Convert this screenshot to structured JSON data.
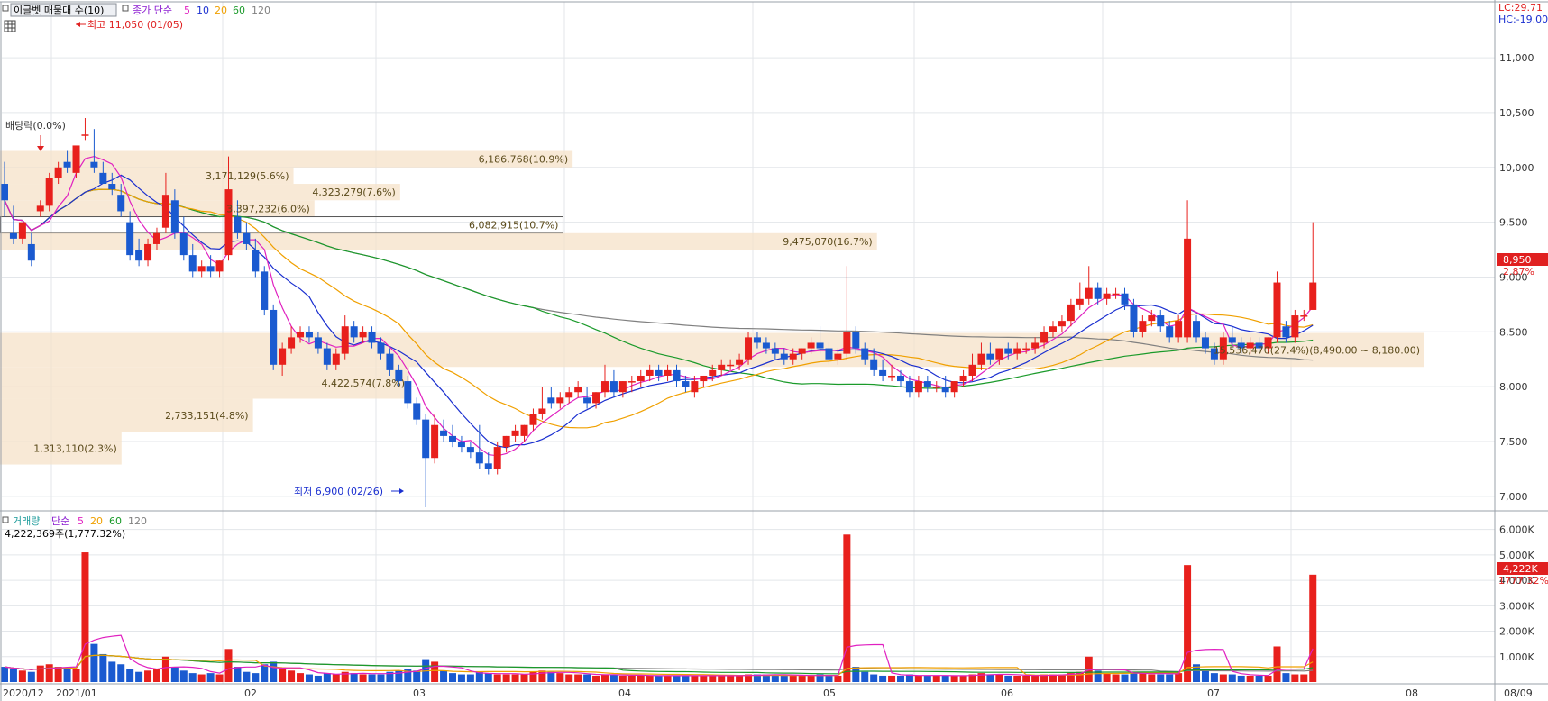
{
  "legend_top": {
    "title": "이글벳 매물대 수(10)",
    "ma_label": "종가 단순",
    "periods": [
      "5",
      "10",
      "20",
      "60",
      "120"
    ],
    "colors": {
      "5": "#e020c0",
      "10": "#1a2fd0",
      "20": "#f0a000",
      "60": "#1a9a2a",
      "120": "#808080",
      "label": "#8a1ad0"
    }
  },
  "legend_bottom": {
    "title": "거래량",
    "ma_label": "단순",
    "periods": [
      "5",
      "20",
      "60",
      "120"
    ],
    "volume_readout": "4,222,369주(1,777.32%)"
  },
  "annotations": {
    "high": "최고 11,050 (01/05)",
    "low": "최저 6,900 (02/26)",
    "ex_dividend": "배당락(0.0%)",
    "lc": "LC:29.71",
    "hc": "HC:-19.00",
    "last_price": "8,950",
    "last_pct": "2.87%",
    "last_volume": "4,222K",
    "last_volume_pct": "1777.32%"
  },
  "price_axis": [
    "11,000",
    "10,500",
    "10,000",
    "9,500",
    "9,000",
    "8,500",
    "8,000",
    "7,500",
    "7,000"
  ],
  "volume_axis": [
    "6,000K",
    "5,000K",
    "4,000K",
    "3,000K",
    "2,000K",
    "1,000K"
  ],
  "date_axis": [
    "2020/12",
    "2021/01",
    "02",
    "03",
    "04",
    "05",
    "06",
    "07",
    "08",
    "08/09"
  ],
  "chart_data": {
    "type": "candlestick",
    "price_range": [
      6800,
      11150
    ],
    "volume_range": [
      0,
      6200
    ],
    "volume_profile": [
      {
        "label": "6,186,768(10.9%)",
        "price_low": 10000,
        "price_high": 10150,
        "volume": 6186768
      },
      {
        "label": "3,171,129(5.6%)",
        "price_low": 9850,
        "price_high": 10000,
        "volume": 3171129
      },
      {
        "label": "4,323,279(7.6%)",
        "price_low": 9700,
        "price_high": 9850,
        "volume": 4323279
      },
      {
        "label": "3,397,232(6.0%)",
        "price_low": 9550,
        "price_high": 9700,
        "volume": 3397232
      },
      {
        "label": "6,082,915(10.7%)",
        "price_low": 9400,
        "price_high": 9550,
        "volume": 6082915
      },
      {
        "label": "9,475,070(16.7%)",
        "price_low": 9250,
        "price_high": 9400,
        "volume": 9475070
      },
      {
        "label": "15,536,470(27.4%)(8,490.00 ~ 8,180.00)",
        "price_low": 8180,
        "price_high": 8490,
        "volume": 15536470
      },
      {
        "label": "4,422,574(7.8%)",
        "price_low": 7890,
        "price_high": 8180,
        "volume": 4422574
      },
      {
        "label": "2,733,151(4.8%)",
        "price_low": 7590,
        "price_high": 7890,
        "volume": 2733151
      },
      {
        "label": "1,313,110(2.3%)",
        "price_low": 7290,
        "price_high": 7590,
        "volume": 1313110
      }
    ],
    "candles": [
      [
        9850,
        10050,
        9700,
        9550,
        600
      ],
      [
        9400,
        9650,
        9350,
        9300,
        500
      ],
      [
        9350,
        9450,
        9500,
        9300,
        450
      ],
      [
        9300,
        9400,
        9150,
        9100,
        400
      ],
      [
        9600,
        9700,
        9650,
        9550,
        650
      ],
      [
        9650,
        9950,
        9900,
        9600,
        700
      ],
      [
        9900,
        10050,
        10000,
        9850,
        600
      ],
      [
        10050,
        10150,
        10000,
        9950,
        550
      ],
      [
        9950,
        10100,
        10200,
        9900,
        500
      ],
      [
        10300,
        10450,
        10300,
        10250,
        5100
      ],
      [
        10050,
        10350,
        10000,
        9950,
        1500
      ],
      [
        9950,
        10050,
        9850,
        9850,
        1100
      ],
      [
        9850,
        9950,
        9800,
        9750,
        800
      ],
      [
        9750,
        9850,
        9600,
        9550,
        700
      ],
      [
        9500,
        9600,
        9200,
        9150,
        500
      ],
      [
        9250,
        9350,
        9150,
        9100,
        400
      ],
      [
        9150,
        9350,
        9300,
        9100,
        450
      ],
      [
        9300,
        9450,
        9400,
        9250,
        500
      ],
      [
        9450,
        9950,
        9750,
        9400,
        1000
      ],
      [
        9700,
        9800,
        9400,
        9350,
        600
      ],
      [
        9400,
        9550,
        9200,
        9150,
        450
      ],
      [
        9200,
        9300,
        9050,
        9000,
        350
      ],
      [
        9050,
        9150,
        9100,
        9000,
        300
      ],
      [
        9100,
        9200,
        9050,
        9000,
        350
      ],
      [
        9050,
        9150,
        9150,
        9000,
        300
      ],
      [
        9200,
        10100,
        9800,
        9150,
        1300
      ],
      [
        9550,
        9700,
        9400,
        9350,
        600
      ],
      [
        9400,
        9500,
        9300,
        9250,
        400
      ],
      [
        9250,
        9350,
        9050,
        9000,
        350
      ],
      [
        9050,
        9100,
        8700,
        8650,
        700
      ],
      [
        8700,
        8750,
        8200,
        8150,
        800
      ],
      [
        8200,
        8400,
        8350,
        8100,
        500
      ],
      [
        8350,
        8550,
        8450,
        8300,
        450
      ],
      [
        8450,
        8550,
        8500,
        8400,
        350
      ],
      [
        8500,
        8550,
        8450,
        8400,
        300
      ],
      [
        8450,
        8500,
        8350,
        8300,
        250
      ],
      [
        8350,
        8400,
        8200,
        8150,
        350
      ],
      [
        8200,
        8350,
        8300,
        8150,
        300
      ],
      [
        8300,
        8650,
        8550,
        8250,
        400
      ],
      [
        8550,
        8600,
        8450,
        8400,
        350
      ],
      [
        8450,
        8550,
        8500,
        8400,
        300
      ],
      [
        8500,
        8550,
        8400,
        8350,
        300
      ],
      [
        8400,
        8450,
        8300,
        8250,
        300
      ],
      [
        8300,
        8350,
        8150,
        8100,
        400
      ],
      [
        8150,
        8200,
        8050,
        8000,
        450
      ],
      [
        8050,
        8100,
        7850,
        7800,
        500
      ],
      [
        7850,
        7900,
        7700,
        7650,
        450
      ],
      [
        7700,
        7750,
        7350,
        6900,
        900
      ],
      [
        7350,
        7750,
        7650,
        7300,
        800
      ],
      [
        7600,
        7700,
        7550,
        7500,
        450
      ],
      [
        7550,
        7650,
        7500,
        7450,
        350
      ],
      [
        7500,
        7550,
        7450,
        7400,
        300
      ],
      [
        7450,
        7500,
        7400,
        7350,
        300
      ],
      [
        7400,
        7650,
        7300,
        7250,
        400
      ],
      [
        7300,
        7400,
        7250,
        7200,
        350
      ],
      [
        7250,
        7500,
        7450,
        7200,
        300
      ],
      [
        7450,
        7550,
        7550,
        7400,
        300
      ],
      [
        7550,
        7650,
        7600,
        7500,
        300
      ],
      [
        7550,
        7650,
        7650,
        7500,
        300
      ],
      [
        7650,
        7800,
        7750,
        7600,
        400
      ],
      [
        7750,
        8000,
        7800,
        7700,
        450
      ],
      [
        7900,
        8000,
        7850,
        7800,
        400
      ],
      [
        7850,
        7950,
        7900,
        7800,
        350
      ],
      [
        7900,
        8000,
        7950,
        7850,
        300
      ],
      [
        7950,
        8050,
        8000,
        7900,
        300
      ],
      [
        7900,
        8000,
        7850,
        7800,
        300
      ],
      [
        7850,
        7950,
        7950,
        7800,
        250
      ],
      [
        7950,
        8200,
        8050,
        7900,
        300
      ],
      [
        8050,
        8150,
        7950,
        7900,
        300
      ],
      [
        7950,
        8050,
        8050,
        7900,
        250
      ],
      [
        8050,
        8100,
        8050,
        7950,
        250
      ],
      [
        8050,
        8150,
        8100,
        8000,
        250
      ],
      [
        8100,
        8200,
        8150,
        8050,
        250
      ],
      [
        8150,
        8200,
        8100,
        8050,
        250
      ],
      [
        8100,
        8200,
        8150,
        8050,
        250
      ],
      [
        8150,
        8200,
        8050,
        8000,
        250
      ],
      [
        8050,
        8100,
        8000,
        7950,
        250
      ],
      [
        7950,
        8100,
        8050,
        7900,
        250
      ],
      [
        8050,
        8100,
        8100,
        8000,
        250
      ],
      [
        8100,
        8200,
        8150,
        8050,
        250
      ],
      [
        8150,
        8250,
        8200,
        8100,
        250
      ],
      [
        8200,
        8250,
        8200,
        8150,
        250
      ],
      [
        8200,
        8300,
        8250,
        8150,
        250
      ],
      [
        8250,
        8500,
        8450,
        8200,
        300
      ],
      [
        8450,
        8500,
        8400,
        8350,
        300
      ],
      [
        8400,
        8450,
        8350,
        8300,
        300
      ],
      [
        8350,
        8400,
        8300,
        8250,
        300
      ],
      [
        8300,
        8350,
        8250,
        8200,
        250
      ],
      [
        8250,
        8350,
        8300,
        8200,
        250
      ],
      [
        8300,
        8350,
        8350,
        8250,
        250
      ],
      [
        8350,
        8450,
        8400,
        8300,
        250
      ],
      [
        8400,
        8550,
        8350,
        8300,
        300
      ],
      [
        8350,
        8400,
        8250,
        8200,
        250
      ],
      [
        8250,
        8350,
        8300,
        8200,
        250
      ],
      [
        8300,
        9100,
        8500,
        8250,
        5800
      ],
      [
        8500,
        8550,
        8350,
        8300,
        600
      ],
      [
        8350,
        8400,
        8250,
        8200,
        400
      ],
      [
        8250,
        8350,
        8150,
        8100,
        300
      ],
      [
        8150,
        8250,
        8100,
        8050,
        250
      ],
      [
        8100,
        8200,
        8100,
        8050,
        250
      ],
      [
        8100,
        8150,
        8050,
        8000,
        250
      ],
      [
        8050,
        8100,
        7950,
        7900,
        300
      ],
      [
        7950,
        8100,
        8050,
        7900,
        250
      ],
      [
        8050,
        8100,
        8000,
        7950,
        250
      ],
      [
        8000,
        8050,
        8000,
        7950,
        250
      ],
      [
        8000,
        8100,
        7950,
        7900,
        250
      ],
      [
        7950,
        8050,
        8050,
        7900,
        250
      ],
      [
        8050,
        8150,
        8100,
        8000,
        250
      ],
      [
        8100,
        8300,
        8200,
        8050,
        300
      ],
      [
        8200,
        8400,
        8300,
        8150,
        350
      ],
      [
        8300,
        8400,
        8250,
        8200,
        300
      ],
      [
        8250,
        8350,
        8350,
        8200,
        300
      ],
      [
        8350,
        8400,
        8300,
        8250,
        250
      ],
      [
        8300,
        8400,
        8350,
        8250,
        250
      ],
      [
        8350,
        8400,
        8350,
        8300,
        250
      ],
      [
        8350,
        8450,
        8400,
        8300,
        250
      ],
      [
        8400,
        8550,
        8500,
        8350,
        300
      ],
      [
        8500,
        8600,
        8550,
        8450,
        300
      ],
      [
        8550,
        8650,
        8600,
        8500,
        300
      ],
      [
        8600,
        8800,
        8750,
        8550,
        350
      ],
      [
        8750,
        8950,
        8800,
        8700,
        400
      ],
      [
        8800,
        9100,
        8900,
        8750,
        1000
      ],
      [
        8900,
        8950,
        8800,
        8750,
        450
      ],
      [
        8800,
        8900,
        8850,
        8750,
        350
      ],
      [
        8850,
        8900,
        8850,
        8800,
        300
      ],
      [
        8850,
        8900,
        8750,
        8700,
        300
      ],
      [
        8750,
        8800,
        8500,
        8450,
        400
      ],
      [
        8500,
        8650,
        8600,
        8450,
        350
      ],
      [
        8600,
        8700,
        8650,
        8550,
        300
      ],
      [
        8650,
        8700,
        8550,
        8500,
        300
      ],
      [
        8550,
        8600,
        8450,
        8400,
        300
      ],
      [
        8450,
        8650,
        8600,
        8400,
        350
      ],
      [
        8450,
        9700,
        9350,
        8400,
        4600
      ],
      [
        8600,
        8650,
        8450,
        8400,
        700
      ],
      [
        8450,
        8500,
        8350,
        8300,
        450
      ],
      [
        8350,
        8400,
        8250,
        8200,
        350
      ],
      [
        8250,
        8500,
        8450,
        8200,
        300
      ],
      [
        8450,
        8550,
        8400,
        8350,
        300
      ],
      [
        8400,
        8450,
        8350,
        8300,
        250
      ],
      [
        8350,
        8450,
        8400,
        8300,
        250
      ],
      [
        8400,
        8450,
        8350,
        8300,
        250
      ],
      [
        8350,
        8450,
        8450,
        8300,
        250
      ],
      [
        8450,
        9050,
        8950,
        8400,
        1400
      ],
      [
        8550,
        8600,
        8450,
        8400,
        350
      ],
      [
        8450,
        8700,
        8650,
        8400,
        300
      ],
      [
        8650,
        8700,
        8650,
        8600,
        300
      ],
      [
        8700,
        9500,
        8950,
        8800,
        4222
      ]
    ]
  }
}
